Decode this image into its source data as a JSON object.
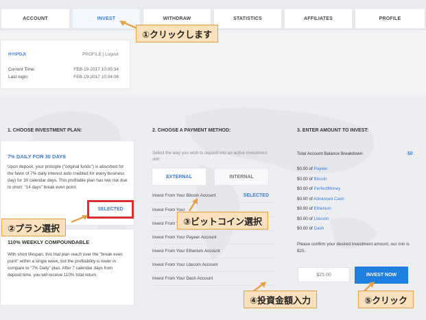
{
  "nav": {
    "items": [
      "ACCOUNT",
      "INVEST",
      "WITHDRAW",
      "STATISTICS",
      "AFFILIATES",
      "PROFILE"
    ],
    "active": "INVEST"
  },
  "user": {
    "name": "HYIPOJI",
    "profile_link": "PROFILE",
    "separator": "|",
    "logout_link": "Logout",
    "current_time_label": "Current Time:",
    "current_time_value": "FEB-19-2017 10:05:34",
    "last_login_label": "Last login:",
    "last_login_value": "FEB-19-2017 10:04:08"
  },
  "sections": {
    "plan_heading": "1. CHOOSE INVESTMENT PLAN:",
    "payment_heading": "2. CHOOSE A PAYMENT METHOD:",
    "amount_heading": "3. ENTER AMOUNT TO INVEST:"
  },
  "plans": [
    {
      "title": "7% DAILY FOR 30 DAYS",
      "description": "Upon deposit, your principle (\"original funds\") is absorbed for the favor of 7% daily interest auto credited for every business day) for 30 calendar days. This profitable plan has low risk due to short: \"14 days\" break even point.",
      "selected_label": "SELECTED"
    },
    {
      "title": "110% WEEKLY COMPOUNDABLE",
      "description": "With short lifespan, this trial plan reach over the \"break even point\" within a single week, but the profitability is lower in compare to \"7% Daily\" plan. After 7 calendar days from deposit time, you will receive 110% total return."
    }
  ],
  "payment": {
    "description": "Select the way you wish to deposit into an active investment slot:",
    "tabs": [
      "EXTERNAL",
      "INTERNAL"
    ],
    "active_tab": "EXTERNAL",
    "methods": [
      "Invest From Your Bitcoin Account",
      "Invest From Your",
      "Invest From Your",
      "Invest From Your Payeer Account",
      "Invest From Your Etherium Account",
      "Invest From Your Litecoin Account",
      "Invest From Your Dash Account"
    ],
    "selected_label": "SELECTED"
  },
  "amount": {
    "breakdown_label": "Total Account Balance Breakdown:",
    "breakdown_value": "$0",
    "balances": [
      {
        "amount": "$0.00 of",
        "currency": "Payeer"
      },
      {
        "amount": "$0.00 of",
        "currency": "Bitcoin"
      },
      {
        "amount": "$0.00 of",
        "currency": "PerfectMoney"
      },
      {
        "amount": "$0.00 of",
        "currency": "Advanced Cash"
      },
      {
        "amount": "$0.00 of",
        "currency": "Etherium"
      },
      {
        "amount": "$0.00 of",
        "currency": "Litecoin"
      },
      {
        "amount": "$0.00 of",
        "currency": "Dash"
      }
    ],
    "confirm_text": "Please confirm your desired investment amount, our min is $25.",
    "input_placeholder": "$25.00",
    "invest_button": "INVEST NOW"
  },
  "annotations": {
    "step1": "①クリックします",
    "step2": "②プラン選択",
    "step3": "③ビットコイン選択",
    "step4": "④投資金額入力",
    "step5": "⑤クリック"
  },
  "colors": {
    "accent": "#3a7bd5",
    "button": "#1f7fe0",
    "highlight_border": "#d9302f",
    "callout_bg": "#fbe0bd",
    "callout_border": "#e8a043"
  }
}
